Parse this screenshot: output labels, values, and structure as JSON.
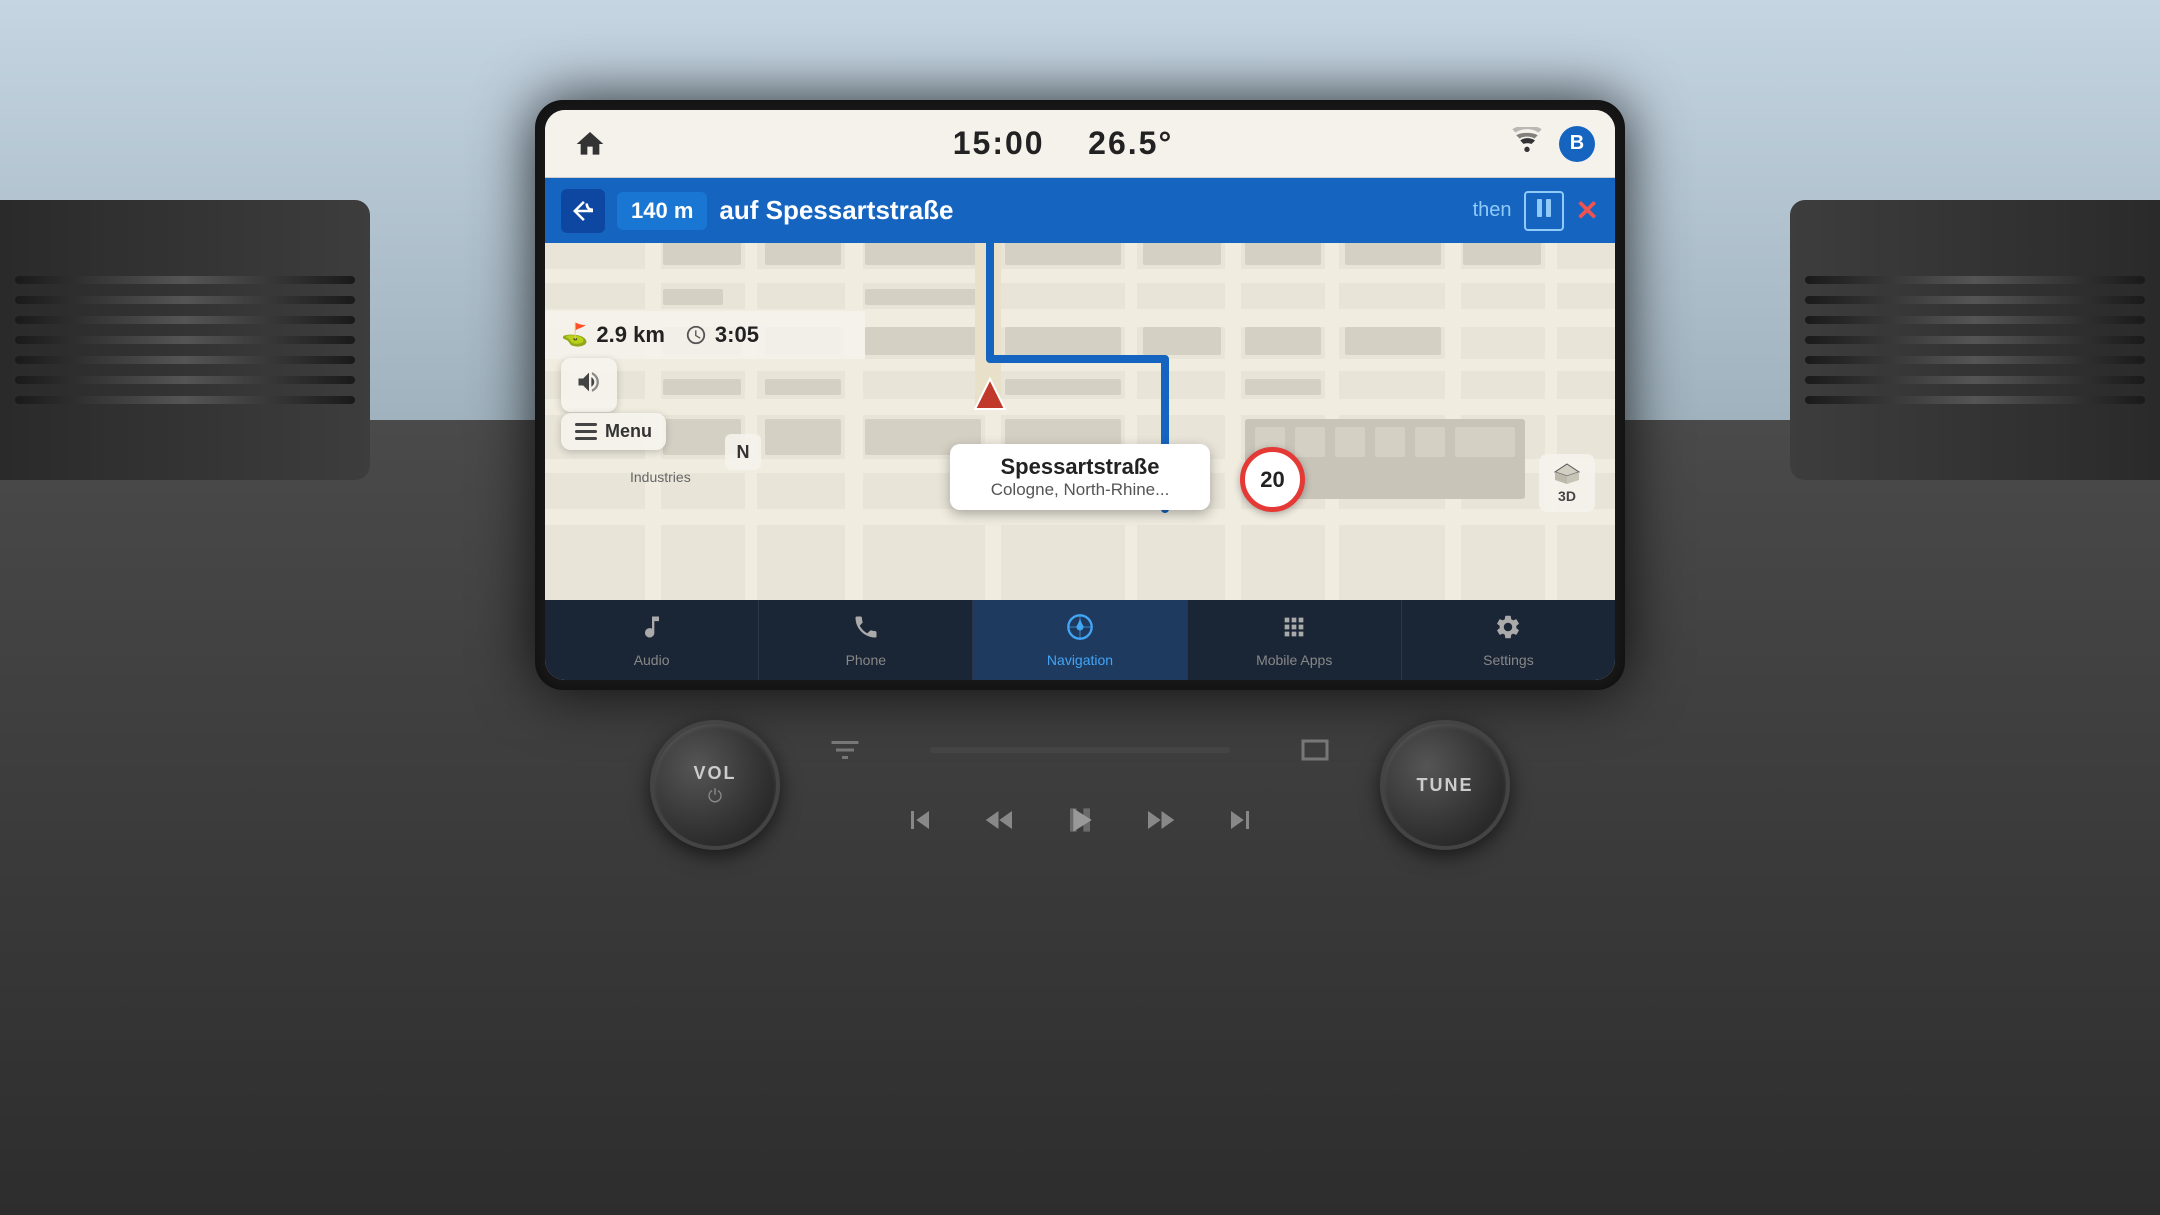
{
  "dashboard": {
    "background_color": "#b8ccd8"
  },
  "header": {
    "home_icon": "⌂",
    "time": "15:00",
    "temperature": "26.5°",
    "wifi_icon": "wifi",
    "bluetooth_icon": "B"
  },
  "nav_bar": {
    "turn_icon": "↩",
    "distance": "140 m",
    "street": "auf Spessartstraße",
    "then": "then",
    "next_turn": "||",
    "close_icon": "✕"
  },
  "route_info": {
    "distance_icon": "⛳",
    "distance": "2.9 km",
    "time_icon": "⏱",
    "time": "3:05"
  },
  "map": {
    "location_street": "Spessartstraße",
    "location_city": "Cologne, North-Rhine...",
    "speed_limit": "20",
    "compass_label": "3D",
    "north_label": "N",
    "volume_icon": "🔊",
    "menu_label": "Menu"
  },
  "bottom_nav": {
    "items": [
      {
        "id": "audio",
        "icon": "♪",
        "label": "Audio",
        "active": false
      },
      {
        "id": "phone",
        "icon": "📞",
        "label": "Phone",
        "active": false
      },
      {
        "id": "navigation",
        "icon": "⊕",
        "label": "Navigation",
        "active": true
      },
      {
        "id": "mobile-apps",
        "icon": "⊞",
        "label": "Mobile Apps",
        "active": false
      },
      {
        "id": "settings",
        "icon": "≡",
        "label": "Settings",
        "active": false
      }
    ]
  },
  "physical_controls": {
    "vol_label": "VOL",
    "vol_sublabel": "⏻",
    "tune_label": "TUNE",
    "prev_icon": "⏮",
    "rewind_icon": "⏪",
    "play_pause_icon": "⏯",
    "fast_forward_icon": "⏩",
    "next_icon": "⏭",
    "equalizer_icon": "⊟",
    "screen_icon": "⊡"
  }
}
